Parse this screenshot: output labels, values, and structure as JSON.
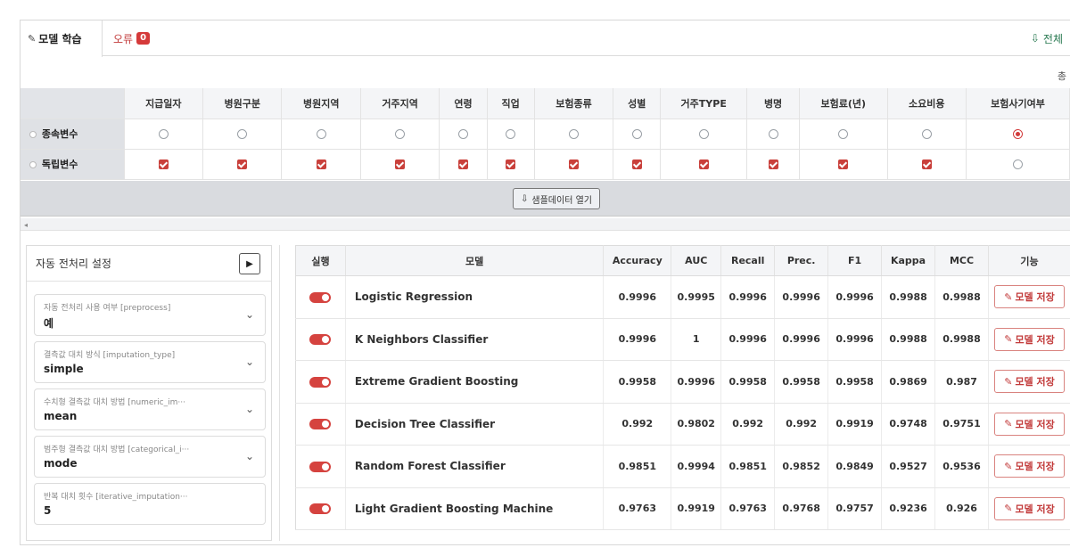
{
  "tabs": {
    "model_training": "모델 학습",
    "errors": "오류",
    "error_count": "0",
    "all": "전체"
  },
  "top_right_label": "총",
  "variables": {
    "columns": [
      "지급일자",
      "병원구분",
      "병원지역",
      "거주지역",
      "연령",
      "직업",
      "보험종류",
      "성별",
      "거주TYPE",
      "병명",
      "보험료(년)",
      "소요비용",
      "보험사기여부"
    ],
    "dependent_label": "종속변수",
    "independent_label": "독립변수",
    "dependent_selected_index": 12,
    "independent_checked": [
      true,
      true,
      true,
      true,
      true,
      true,
      true,
      true,
      true,
      true,
      true,
      true,
      false
    ]
  },
  "sample_button": "샘플데이터 열기",
  "settings": {
    "title": "자동 전처리 설정",
    "fields": [
      {
        "label": "자동 전처리 사용 여부 [preprocess]",
        "value": "예"
      },
      {
        "label": "결측값 대치 방식 [imputation_type]",
        "value": "simple"
      },
      {
        "label": "수치형 결측값 대치 방법 [numeric_im···",
        "value": "mean"
      },
      {
        "label": "범주형 결측값 대치 방법 [categorical_i···",
        "value": "mode"
      },
      {
        "label": "반복 대치 횟수 [iterative_imputation···",
        "value": "5"
      }
    ]
  },
  "results": {
    "headers": [
      "실행",
      "모델",
      "Accuracy",
      "AUC",
      "Recall",
      "Prec.",
      "F1",
      "Kappa",
      "MCC",
      "기능"
    ],
    "action_label": "모델 저장",
    "rows": [
      {
        "model": "Logistic Regression",
        "accuracy": "0.9996",
        "auc": "0.9995",
        "recall": "0.9996",
        "prec": "0.9996",
        "f1": "0.9996",
        "kappa": "0.9988",
        "mcc": "0.9988"
      },
      {
        "model": "K Neighbors Classifier",
        "accuracy": "0.9996",
        "auc": "1",
        "recall": "0.9996",
        "prec": "0.9996",
        "f1": "0.9996",
        "kappa": "0.9988",
        "mcc": "0.9988"
      },
      {
        "model": "Extreme Gradient Boosting",
        "accuracy": "0.9958",
        "auc": "0.9996",
        "recall": "0.9958",
        "prec": "0.9958",
        "f1": "0.9958",
        "kappa": "0.9869",
        "mcc": "0.987"
      },
      {
        "model": "Decision Tree Classifier",
        "accuracy": "0.992",
        "auc": "0.9802",
        "recall": "0.992",
        "prec": "0.992",
        "f1": "0.9919",
        "kappa": "0.9748",
        "mcc": "0.9751"
      },
      {
        "model": "Random Forest Classifier",
        "accuracy": "0.9851",
        "auc": "0.9994",
        "recall": "0.9851",
        "prec": "0.9852",
        "f1": "0.9849",
        "kappa": "0.9527",
        "mcc": "0.9536"
      },
      {
        "model": "Light Gradient Boosting Machine",
        "accuracy": "0.9763",
        "auc": "0.9919",
        "recall": "0.9763",
        "prec": "0.9768",
        "f1": "0.9757",
        "kappa": "0.9236",
        "mcc": "0.926"
      }
    ]
  },
  "colors": {
    "accent": "#d5433f",
    "success": "#2a7a52"
  },
  "icons": {
    "model_tab": "wrench-icon",
    "all": "download-icon",
    "sample": "download-icon",
    "panel_button": "play-icon",
    "action": "edit-icon"
  }
}
